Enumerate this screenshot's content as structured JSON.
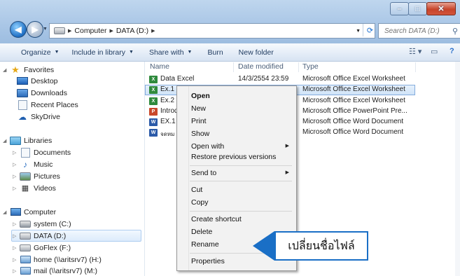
{
  "address": {
    "segments": [
      "Computer",
      "DATA (D:)"
    ]
  },
  "search": {
    "placeholder": "Search DATA (D:)"
  },
  "toolbar": {
    "organize": "Organize",
    "include": "Include in library",
    "share": "Share with",
    "burn": "Burn",
    "new_folder": "New folder"
  },
  "navpane": {
    "favorites": "Favorites",
    "desktop": "Desktop",
    "downloads": "Downloads",
    "recent": "Recent Places",
    "skydrive": "SkyDrive",
    "libraries": "Libraries",
    "documents": "Documents",
    "music": "Music",
    "pictures": "Pictures",
    "videos": "Videos",
    "computer": "Computer",
    "system": "system (C:)",
    "data": "DATA (D:)",
    "goflex": "GoFlex (F:)",
    "home": "home (\\\\aritsrv7) (H:)",
    "mail": "mail (\\\\aritsrv7) (M:)"
  },
  "columns": {
    "name": "Name",
    "date": "Date modified",
    "type": "Type"
  },
  "files": [
    {
      "name": "Data Excel",
      "date": "14/3/2554 23:59",
      "type": "Microsoft Office Excel Worksheet",
      "kind": "xls"
    },
    {
      "name": "Ex.1",
      "date": "",
      "type": "Microsoft Office Excel Worksheet",
      "kind": "xls"
    },
    {
      "name": "Ex.2",
      "date": "",
      "type": "Microsoft Office Excel Worksheet",
      "kind": "xls"
    },
    {
      "name": "Introd",
      "date": "",
      "type": "Microsoft Office PowerPoint Pre...",
      "kind": "ppt"
    },
    {
      "name": "EX.1",
      "date": "",
      "type": "Microsoft Office Word Document",
      "kind": "doc"
    },
    {
      "name": "จดหม",
      "date": "",
      "type": "Microsoft Office Word Document",
      "kind": "doc"
    }
  ],
  "menu": {
    "open": "Open",
    "new": "New",
    "print": "Print",
    "show": "Show",
    "open_with": "Open with",
    "restore": "Restore previous versions",
    "send_to": "Send to",
    "cut": "Cut",
    "copy": "Copy",
    "create_shortcut": "Create shortcut",
    "delete": "Delete",
    "rename": "Rename",
    "properties": "Properties"
  },
  "callout": {
    "text": "เปลี่ยนชื่อไฟล์"
  }
}
